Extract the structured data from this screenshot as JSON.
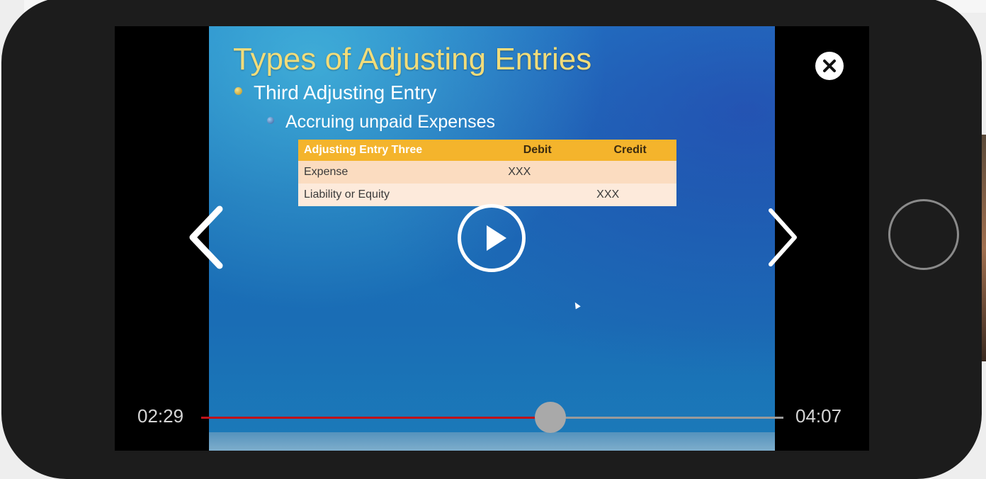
{
  "slide": {
    "title": "Types of Adjusting Entries",
    "bullet_level1": "Third Adjusting Entry",
    "bullet_level2": "Accruing unpaid Expenses",
    "table": {
      "headers": [
        "Adjusting Entry Three",
        "Debit",
        "Credit"
      ],
      "rows": [
        [
          "Expense",
          "XXX",
          ""
        ],
        [
          "Liability or Equity",
          "",
          "XXX"
        ]
      ]
    }
  },
  "player": {
    "current_time": "02:29",
    "total_time": "04:07",
    "progress_fraction": 0.6,
    "accent_color": "#c0121a",
    "icons": {
      "play": "play-icon",
      "close": "close-icon",
      "prev": "chevron-left-icon",
      "next": "chevron-right-icon"
    }
  }
}
